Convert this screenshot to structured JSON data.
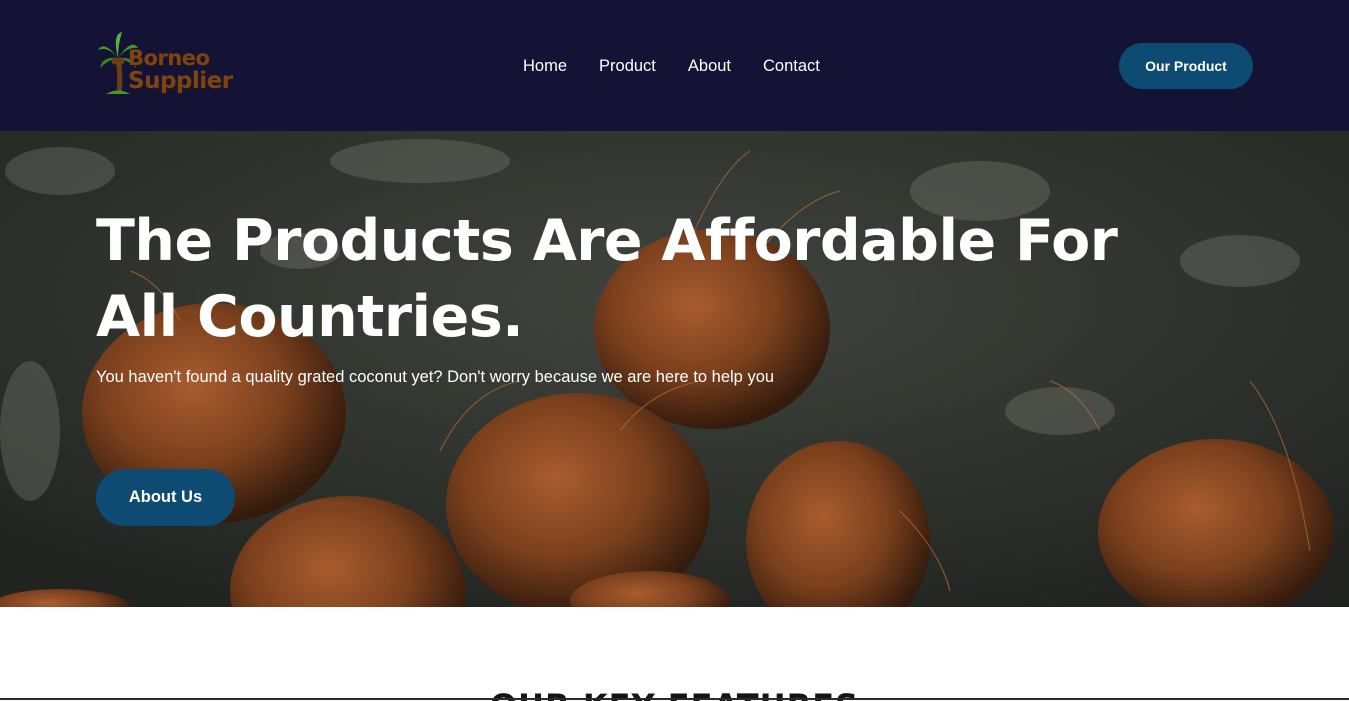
{
  "header": {
    "logo": {
      "line1": "Borneo",
      "line2": "Supplier",
      "icon": "palm-tree-coconut-logo"
    },
    "nav": [
      {
        "label": "Home"
      },
      {
        "label": "Product"
      },
      {
        "label": "About"
      },
      {
        "label": "Contact"
      }
    ],
    "cta_label": "Our Product"
  },
  "hero": {
    "title": "The Products Are Affordable For All Countries.",
    "subtitle": "You haven't found a quality grated coconut yet? Don't worry because we are here to help you",
    "button_label": "About Us",
    "background": "coconuts-on-dark-concrete-photo"
  },
  "features": {
    "title": "OUR KEY FEATURES"
  },
  "colors": {
    "navbar_bg": "#141235",
    "button_bg": "#0e4b73",
    "text_light": "#ffffff"
  }
}
